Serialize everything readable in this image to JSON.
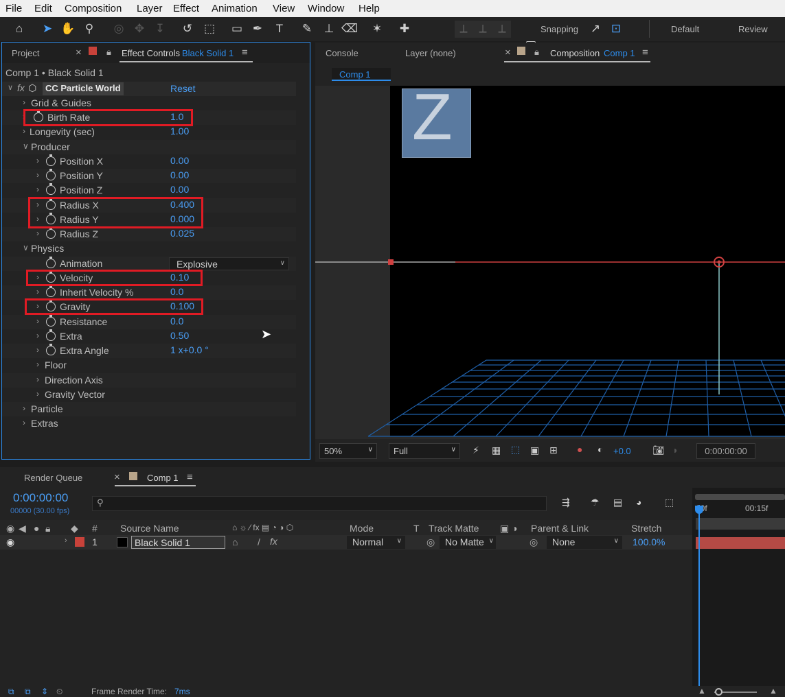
{
  "menu": [
    "File",
    "Edit",
    "Composition",
    "Layer",
    "Effect",
    "Animation",
    "View",
    "Window",
    "Help"
  ],
  "toolbar": {
    "snapping_label": "Snapping",
    "workspace_default": "Default",
    "workspace_review": "Review"
  },
  "left_panel": {
    "tab_project": "Project",
    "tab_effect_controls": "Effect Controls",
    "tab_effect_layer": "Black Solid 1",
    "breadcrumb": "Comp 1 • Black Solid 1",
    "effect_name": "CC Particle World",
    "reset_label": "Reset",
    "rows": [
      {
        "label": "Grid & Guides",
        "value": ""
      },
      {
        "label": "Birth Rate",
        "value": "1.0"
      },
      {
        "label": "Longevity (sec)",
        "value": "1.00"
      },
      {
        "label": "Producer",
        "value": ""
      },
      {
        "label": "Position X",
        "value": "0.00"
      },
      {
        "label": "Position Y",
        "value": "0.00"
      },
      {
        "label": "Position Z",
        "value": "0.00"
      },
      {
        "label": "Radius X",
        "value": "0.400"
      },
      {
        "label": "Radius Y",
        "value": "0.000"
      },
      {
        "label": "Radius Z",
        "value": "0.025"
      },
      {
        "label": "Physics",
        "value": ""
      },
      {
        "label": "Animation",
        "value": "Explosive"
      },
      {
        "label": "Velocity",
        "value": "0.10"
      },
      {
        "label": "Inherit Velocity %",
        "value": "0.0"
      },
      {
        "label": "Gravity",
        "value": "0.100"
      },
      {
        "label": "Resistance",
        "value": "0.0"
      },
      {
        "label": "Extra",
        "value": "0.50"
      },
      {
        "label": "Extra Angle",
        "value": "1 x+0.0 °"
      },
      {
        "label": "Floor",
        "value": ""
      },
      {
        "label": "Direction Axis",
        "value": ""
      },
      {
        "label": "Gravity Vector",
        "value": ""
      },
      {
        "label": "Particle",
        "value": ""
      },
      {
        "label": "Extras",
        "value": ""
      }
    ]
  },
  "comp_panel": {
    "tab_console": "Console",
    "tab_layer": "Layer (none)",
    "tab_composition": "Composition",
    "tab_comp_name": "Comp 1",
    "subtab": "Comp 1",
    "zoom": "50%",
    "resolution": "Full",
    "exposure": "+0.0",
    "timecode": "0:00:00:00",
    "logo_letter": "Z"
  },
  "timeline": {
    "tab_render_queue": "Render Queue",
    "tab_comp": "Comp 1",
    "current_time": "0:00:00:00",
    "frame_info": "00000 (30.00 fps)",
    "search_placeholder": "",
    "ruler_labels": [
      "00f",
      "00:15f"
    ],
    "columns": {
      "num": "#",
      "source_name": "Source Name",
      "mode": "Mode",
      "t": "T",
      "track_matte": "Track Matte",
      "parent_link": "Parent & Link",
      "stretch": "Stretch"
    },
    "layers": [
      {
        "num": "1",
        "name": "Black Solid 1",
        "mode": "Normal",
        "matte": "No Matte",
        "parent": "None",
        "stretch": "100.0%",
        "label_color": "#c8423a"
      }
    ]
  },
  "status": {
    "render_time_label": "Frame Render Time:",
    "render_time_value": "7ms"
  },
  "colors": {
    "accent": "#2d8ceb",
    "highlight": "#e01b24",
    "layer_bar": "#b54a45"
  }
}
